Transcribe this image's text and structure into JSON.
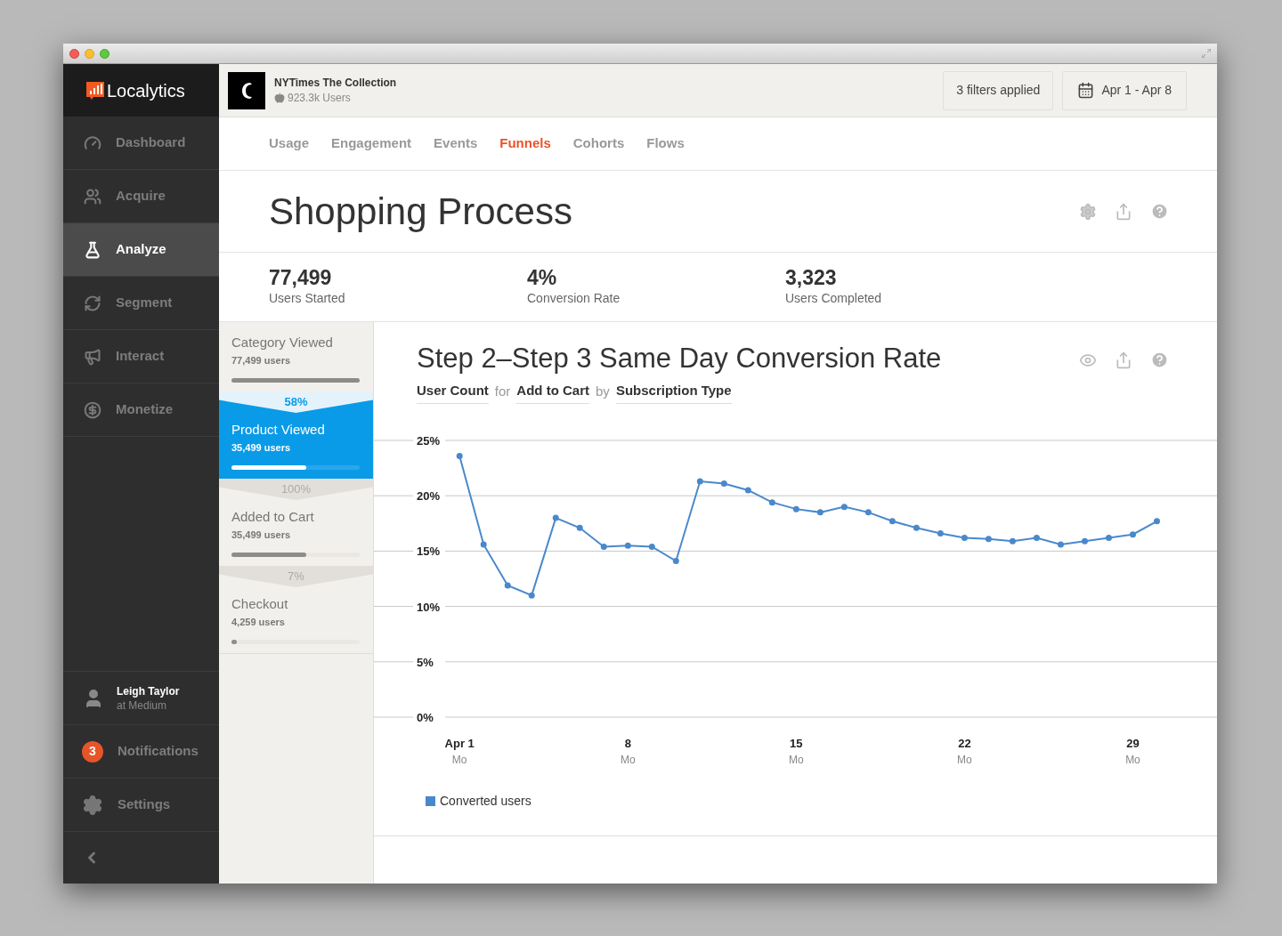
{
  "sidebar": {
    "logo": "Localytics",
    "items": [
      {
        "label": "Dashboard",
        "selected": false
      },
      {
        "label": "Acquire",
        "selected": false
      },
      {
        "label": "Analyze",
        "selected": true
      },
      {
        "label": "Segment",
        "selected": false
      },
      {
        "label": "Interact",
        "selected": false
      },
      {
        "label": "Monetize",
        "selected": false
      }
    ],
    "user": {
      "name": "Leigh Taylor",
      "org": "at Medium"
    },
    "bottom_items": [
      {
        "kind": "badge",
        "label": "Notifications",
        "badge": "3"
      },
      {
        "kind": "icon",
        "label": "Settings"
      }
    ]
  },
  "header": {
    "app_name": "NYTimes The Collection",
    "app_users": "923.3k Users",
    "filters": "3 filters applied",
    "date_range": "Apr 1 - Apr 8"
  },
  "tabs": [
    {
      "label": "Usage",
      "selected": false
    },
    {
      "label": "Engagement",
      "selected": false
    },
    {
      "label": "Events",
      "selected": false
    },
    {
      "label": "Funnels",
      "selected": true
    },
    {
      "label": "Cohorts",
      "selected": false
    },
    {
      "label": "Flows",
      "selected": false
    }
  ],
  "report": {
    "title": "Shopping Process",
    "stats": [
      {
        "value": "77,499",
        "label": "Users Started"
      },
      {
        "value": "4%",
        "label": "Conversion Rate"
      },
      {
        "value": "3,323",
        "label": "Users Completed"
      }
    ]
  },
  "funnel": [
    {
      "name": "Category Viewed",
      "users": "77,499 users",
      "level": 1,
      "selected": false
    },
    {
      "conversion": "58%",
      "name": "Product Viewed",
      "users": "35,499 users",
      "level": 0.58,
      "selected": true
    },
    {
      "conversion": "100%",
      "name": "Added to Cart",
      "users": "35,499 users",
      "level": 0.58,
      "selected": false
    },
    {
      "conversion": "7%",
      "name": "Checkout",
      "users": "4,259 users",
      "level": 0.04,
      "selected": false
    }
  ],
  "chart": {
    "title": "Step 2–Step 3 Same Day Conversion Rate",
    "subtitle": {
      "metric": "User Count",
      "for": "for",
      "event": "Add to Cart",
      "by": "by",
      "segment": "Subscription Type"
    },
    "x_sublabels": [
      "Mo",
      "Mo",
      "Mo",
      "Mo",
      "Mo"
    ],
    "chart_data": {
      "type": "line",
      "x": [
        1,
        2,
        3,
        4,
        5,
        6,
        7,
        8,
        9,
        10,
        11,
        12,
        13,
        14,
        15,
        16,
        17,
        18,
        19,
        20,
        21,
        22,
        23,
        24,
        25,
        26,
        27,
        28,
        29,
        30
      ],
      "series": [
        {
          "name": "Converted users",
          "color": "#4a88cc",
          "marker": "circle",
          "values": [
            23.6,
            15.6,
            11.9,
            11.0,
            18.0,
            17.1,
            15.4,
            15.5,
            15.4,
            14.1,
            21.3,
            21.1,
            20.5,
            19.4,
            18.8,
            18.5,
            19.0,
            18.5,
            17.7,
            17.1,
            16.6,
            16.2,
            16.1,
            15.9,
            16.2,
            15.6,
            15.9,
            16.2,
            16.5,
            17.7
          ]
        }
      ],
      "xlim": [
        0.4,
        32.5
      ],
      "ylim": [
        0,
        25
      ],
      "grid": true,
      "yticks": [
        {
          "value": 25,
          "label": "25%"
        },
        {
          "value": 20,
          "label": "20%"
        },
        {
          "value": 15,
          "label": "15%"
        },
        {
          "value": 10,
          "label": "10%"
        },
        {
          "value": 5,
          "label": "5%"
        },
        {
          "value": 0,
          "label": "0%"
        }
      ],
      "xticks": [
        {
          "value": 1,
          "label": "Apr 1"
        },
        {
          "value": 8,
          "label": "8"
        },
        {
          "value": 15,
          "label": "15"
        },
        {
          "value": 22,
          "label": "22"
        },
        {
          "value": 29,
          "label": "29"
        }
      ]
    }
  }
}
